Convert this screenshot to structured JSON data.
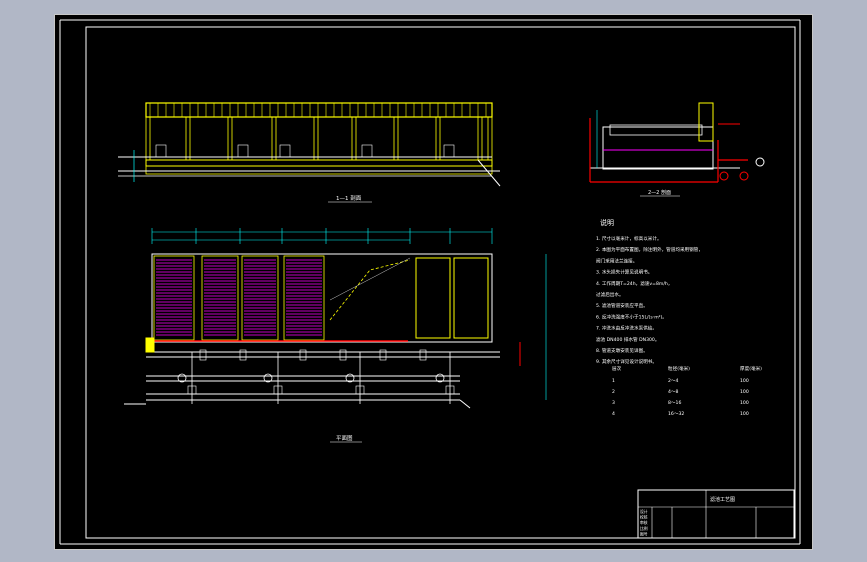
{
  "sheet": {
    "background": "#000000",
    "viewport_bg": "#b1b7c6",
    "border_color": "#ffffff"
  },
  "colors": {
    "structure": "#ffff00",
    "pipe": "#ffffff",
    "dimension": "#00ffff",
    "filter_media": "#ff00ff",
    "valve": "#ffffff",
    "section_line": "#ff0000",
    "text": "#ffffff"
  },
  "views": {
    "elevation_title": "1—1 剖面",
    "section_title": "2—2 剖面",
    "plan_title": "平面图"
  },
  "notes": {
    "heading": "说明",
    "lines": [
      "1. 尺寸以毫米计，标高以米计。",
      "2. 本图为平面布置图，除注明外，管道均采用钢管，",
      "   阀门采用法兰连接。",
      "3. 水头损失计算见说明书。",
      "4. 工作周期T=24h，滤速v=8m/h，",
      "   过滤后出水。",
      "5. 滤池管道安装应平直。",
      "6. 反冲洗强度不小于15L/(s·m²)。",
      "7. 冲洗水由反冲洗水泵供给。",
      "   滤池 DN400 排水管 DN300。",
      "8. 管道支墩安装见详图。",
      "9. 其余尺寸详见设计说明书。"
    ],
    "table": {
      "headers": [
        "层次",
        "粒径(毫米)",
        "厚度(毫米)"
      ],
      "rows": [
        [
          "1",
          "2～4",
          "100"
        ],
        [
          "2",
          "4～8",
          "100"
        ],
        [
          "3",
          "8～16",
          "100"
        ],
        [
          "4",
          "16～32",
          "100"
        ]
      ]
    }
  },
  "title_block": {
    "drawing_name": "滤池工艺图",
    "cells": [
      "设计",
      "校核",
      "审核",
      "比例",
      "图号"
    ]
  }
}
